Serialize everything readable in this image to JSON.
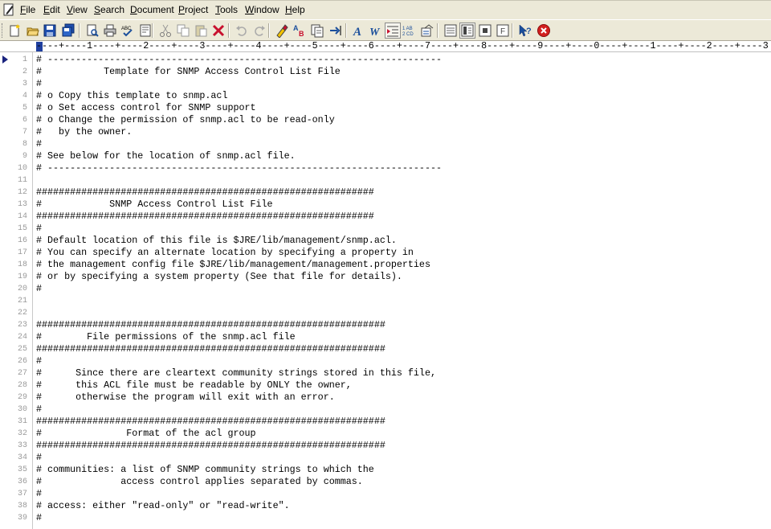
{
  "menu": {
    "items": [
      {
        "accel": "F",
        "rest": "ile"
      },
      {
        "accel": "E",
        "rest": "dit"
      },
      {
        "accel": "V",
        "rest": "iew"
      },
      {
        "accel": "S",
        "rest": "earch"
      },
      {
        "accel": "D",
        "rest": "ocument"
      },
      {
        "accel": "P",
        "rest": "roject"
      },
      {
        "accel": "T",
        "rest": "ools"
      },
      {
        "accel": "W",
        "rest": "indow"
      },
      {
        "accel": "H",
        "rest": "elp"
      }
    ]
  },
  "toolbar": {
    "buttons": [
      "new-file-icon",
      "open-folder-icon",
      "save-icon",
      "save-all-icon",
      "print-preview-icon",
      "print-icon",
      "spell-check-icon",
      "page-setup-icon",
      "cut-icon",
      "copy-icon",
      "paste-icon",
      "delete-icon",
      "undo-icon",
      "redo-icon",
      "find-icon",
      "replace-icon",
      "find-in-files-icon",
      "goto-icon",
      "font-icon",
      "word-wrap-icon",
      "indent-icon",
      "line-numbers-icon",
      "html-toolbar-icon",
      "text-mode-icon",
      "column-mode-icon",
      "hex-mode-icon",
      "file-tree-icon",
      "context-help-icon",
      "close-icon"
    ]
  },
  "ruler": {
    "text": "----+----1----+----2----+----3----+----4----+----5----+----6----+----7----+----8----+----9----+----0----+----1----+----2----+----3"
  },
  "editor": {
    "lines": [
      "# ----------------------------------------------------------------------",
      "#           Template for SNMP Access Control List File",
      "#",
      "# o Copy this template to snmp.acl",
      "# o Set access control for SNMP support",
      "# o Change the permission of snmp.acl to be read-only",
      "#   by the owner.",
      "#",
      "# See below for the location of snmp.acl file.",
      "# ----------------------------------------------------------------------",
      "",
      "############################################################",
      "#            SNMP Access Control List File",
      "############################################################",
      "#",
      "# Default location of this file is $JRE/lib/management/snmp.acl.",
      "# You can specify an alternate location by specifying a property in",
      "# the management config file $JRE/lib/management/management.properties",
      "# or by specifying a system property (See that file for details).",
      "#",
      "",
      "",
      "##############################################################",
      "#        File permissions of the snmp.acl file",
      "##############################################################",
      "#",
      "#      Since there are cleartext community strings stored in this file,",
      "#      this ACL file must be readable by ONLY the owner,",
      "#      otherwise the program will exit with an error.",
      "#",
      "##############################################################",
      "#               Format of the acl group",
      "##############################################################",
      "#",
      "# communities: a list of SNMP community strings to which the",
      "#              access control applies separated by commas.",
      "#",
      "# access: either \"read-only\" or \"read-write\".",
      "#"
    ]
  }
}
